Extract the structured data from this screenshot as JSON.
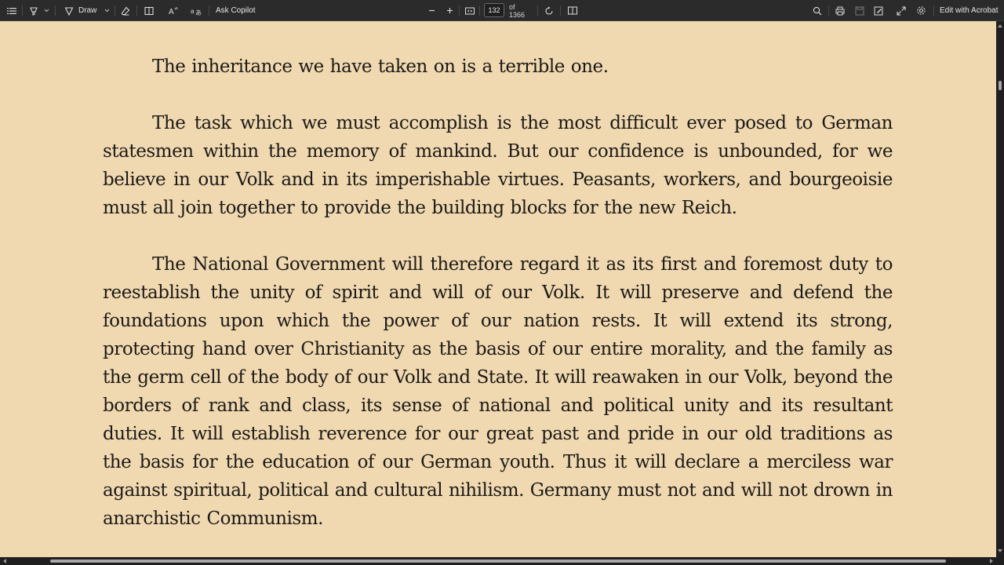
{
  "toolbar": {
    "draw_label": "Draw",
    "ask_copilot_label": "Ask Copilot",
    "current_page": "132",
    "page_total_label": "of 1366",
    "edit_with_acrobat_label": "Edit with Acrobat",
    "icons": {
      "contents": "list-icon",
      "highlight": "highlighter-icon",
      "draw": "draw-pen-icon",
      "erase": "eraser-icon",
      "view": "page-view-icon",
      "read_aloud": "read-aloud-icon",
      "translate": "translate-icon",
      "zoom_out": "minus-icon",
      "zoom_in": "plus-icon",
      "fit": "fit-page-icon",
      "rotate": "rotate-icon",
      "layout": "two-page-icon",
      "search": "search-icon",
      "print": "print-icon",
      "save": "save-icon",
      "save_as": "save-as-icon",
      "fullscreen": "fullscreen-icon",
      "settings": "gear-icon"
    }
  },
  "document": {
    "paragraphs": [
      "The inheritance we have taken on is a terrible one.",
      "The task which we must accomplish is the most difficult ever posed to German statesmen within the memory of mankind. But our confidence is unbounded, for we believe in our Volk and in its imperishable virtues. Peasants, workers, and bourgeoisie must all join together to provide the building blocks for the new Reich.",
      "The National Government will therefore regard it as its first and foremost duty to reestablish the unity of spirit and will of our Volk. It will preserve and defend the foundations upon which the power of our nation rests. It will extend its strong, protecting hand over Christianity as the basis of our entire morality, and the family as the germ cell of the body of our Volk and State. It will reawaken in our Volk, beyond the borders of rank and class, its sense of national and political unity and its resultant duties. It will establish reverence for our great past and pride in our old traditions as the basis for the education of our German youth. Thus it will declare a merciless war against spiritual, political and cultural nihilism. Germany must not and will not drown in anarchistic Communism."
    ]
  },
  "colors": {
    "toolbar_bg": "#2b2b2b",
    "page_bg": "#f0d8b0",
    "text": "#1c1a17"
  }
}
